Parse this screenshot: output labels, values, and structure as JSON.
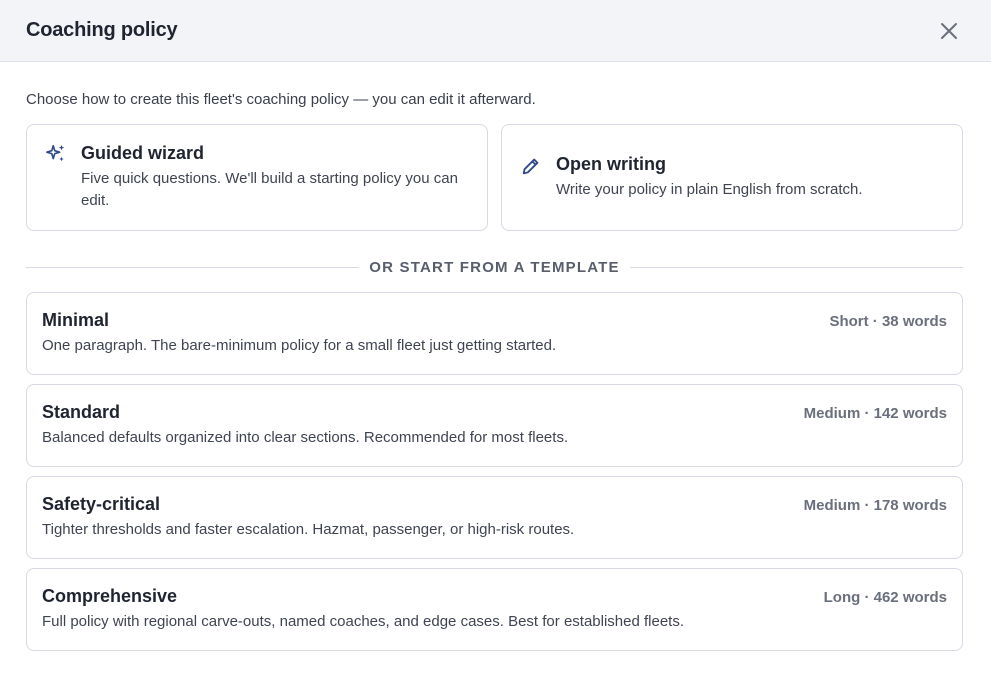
{
  "dialog": {
    "title": "Coaching policy",
    "close_icon": "close-icon"
  },
  "intro": "Choose how to create this fleet's coaching policy — you can edit it afterward.",
  "options": [
    {
      "icon": "sparkles-icon",
      "title": "Guided wizard",
      "description": "Five quick questions. We'll build a starting policy you can edit."
    },
    {
      "icon": "pencil-icon",
      "title": "Open writing",
      "description": "Write your policy in plain English from scratch."
    }
  ],
  "divider_label": "OR START FROM A TEMPLATE",
  "templates": [
    {
      "name": "Minimal",
      "meta": "Short · 38 words",
      "description": "One paragraph. The bare-minimum policy for a small fleet just getting started."
    },
    {
      "name": "Standard",
      "meta": "Medium · 142 words",
      "description": "Balanced defaults organized into clear sections. Recommended for most fleets."
    },
    {
      "name": "Safety-critical",
      "meta": "Medium · 178 words",
      "description": "Tighter thresholds and faster escalation. Hazmat, passenger, or high-risk routes."
    },
    {
      "name": "Comprehensive",
      "meta": "Long · 462 words",
      "description": "Full policy with regional carve-outs, named coaches, and edge cases. Best for established fleets."
    }
  ],
  "colors": {
    "accent": "#2f4a8a",
    "border": "#d7dae3",
    "header_bg": "#f3f4f8"
  }
}
